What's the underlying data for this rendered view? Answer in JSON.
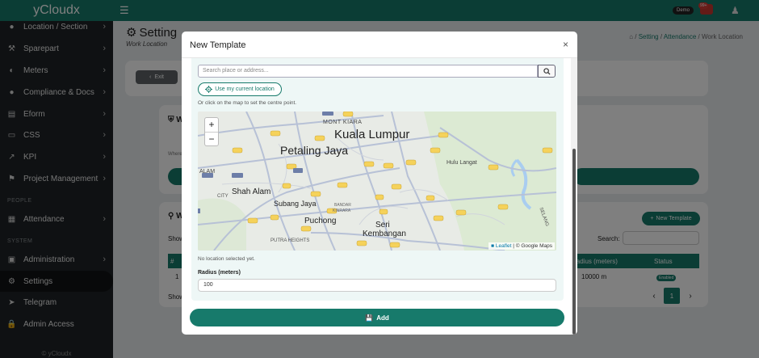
{
  "app": {
    "brand": "yCloudx"
  },
  "sidebar": {
    "items": [
      {
        "label": "Location / Section",
        "icon": "location-icon",
        "top": 0
      },
      {
        "label": "Sparepart",
        "icon": "wrench-icon"
      },
      {
        "label": "Meters",
        "icon": "meter-icon"
      },
      {
        "label": "Compliance & Docs",
        "icon": "compliance-icon"
      },
      {
        "label": "Eform",
        "icon": "form-icon"
      },
      {
        "label": "CSS",
        "icon": "monitor-icon"
      },
      {
        "label": "KPI",
        "icon": "chart-icon"
      },
      {
        "label": "Project Management",
        "icon": "project-icon"
      },
      {
        "label": "Attendance",
        "icon": "attendance-icon"
      },
      {
        "label": "Administration",
        "icon": "admin-icon"
      },
      {
        "label": "Settings",
        "icon": "gear-icon"
      },
      {
        "label": "Telegram",
        "icon": "telegram-icon"
      },
      {
        "label": "Admin Access",
        "icon": "lock-icon"
      }
    ],
    "section_people": "PEOPLE",
    "section_system": "SYSTEM",
    "footer": "© yCloudx"
  },
  "topbar": {
    "demo_label": "Demo",
    "notif_count": "99+"
  },
  "page": {
    "title": "Setting",
    "subtitle": "Work Location",
    "breadcrumb": {
      "b1": "Setting",
      "b2": "Attendance",
      "b3": "Work Location"
    },
    "exit_label": "Exit",
    "new_template_label": "New Template",
    "search_label": "Search:",
    "table_headers": {
      "radius": "Radius (meters)",
      "status": "Status"
    },
    "row": {
      "index": "1",
      "radius": "10000 m",
      "status": "Enabled"
    },
    "page_current": "1",
    "show_label": "Show",
    "card_initial": "W",
    "where_label": "Where"
  },
  "modal": {
    "title": "New Template",
    "close": "×",
    "search_placeholder": "Search place or address...",
    "use_location_label": "Use my current location",
    "hint": "Or click on the map to set the centre point.",
    "no_location": "No location selected yet.",
    "radius_label": "Radius (meters)",
    "radius_value": "100",
    "add_label": "Add",
    "map": {
      "zoom_in": "+",
      "zoom_out": "−",
      "attrib_leaflet": "Leaflet",
      "attrib_rest": "| © Google Maps",
      "labels": {
        "kuala_lumpur": "Kuala Lumpur",
        "petaling_jaya": "Petaling Jaya",
        "mont_kiara": "MONT KIARA",
        "shah_alam": "Shah Alam",
        "subang_jaya": "Subang Jaya",
        "puchong": "Puchong",
        "seri_kembangan_1": "Seri",
        "seri_kembangan_2": "Kembangan",
        "hulu_langat": "Hulu Langat",
        "alam": "ALAM",
        "bandar_kinrara": "BANDAR",
        "kinrara": "KINRARA",
        "putra_heights": "PUTRA HEIGHTS",
        "city": "CITY",
        "selangor": "SELANG"
      }
    }
  }
}
